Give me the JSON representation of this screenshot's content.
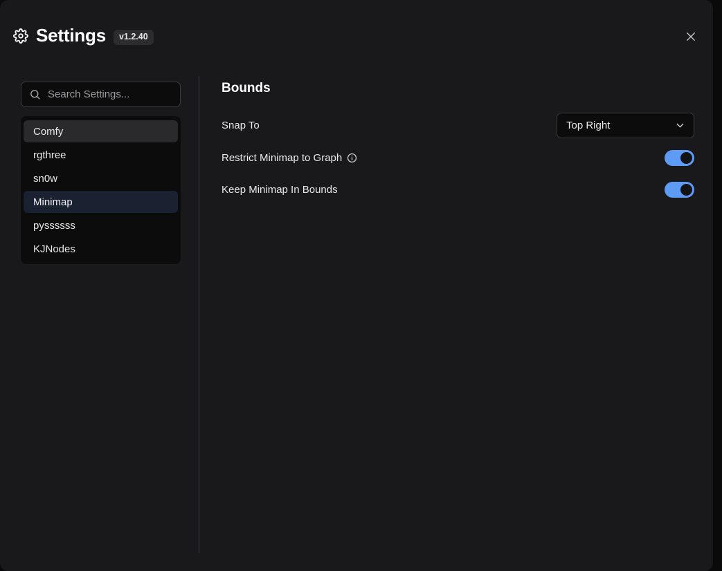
{
  "header": {
    "gear_icon": "gear-icon",
    "title": "Settings",
    "version": "v1.2.40",
    "close_icon": "close-icon"
  },
  "sidebar": {
    "search": {
      "icon": "search-icon",
      "value": "",
      "placeholder": "Search Settings..."
    },
    "items": [
      {
        "label": "Comfy",
        "state": "hovered"
      },
      {
        "label": "rgthree",
        "state": "default"
      },
      {
        "label": "sn0w",
        "state": "default"
      },
      {
        "label": "Minimap",
        "state": "selected"
      },
      {
        "label": "pyssssss",
        "state": "default"
      },
      {
        "label": "KJNodes",
        "state": "default"
      }
    ]
  },
  "content": {
    "section_title": "Bounds",
    "rows": [
      {
        "label": "Snap To",
        "control": "select",
        "value": "Top Right",
        "chevron_icon": "chevron-down-icon"
      },
      {
        "label": "Restrict Minimap to Graph",
        "control": "toggle",
        "info_icon": "info-circle-icon",
        "value": "on"
      },
      {
        "label": "Keep Minimap In Bounds",
        "control": "toggle",
        "value": "on"
      }
    ]
  },
  "colors": {
    "dialog_background": "#19191b",
    "panel_background": "#0c0c0d",
    "page_background": "#0a0a0b",
    "accent_toggle": "#5d9bf5",
    "selected_item": "#1a2231",
    "hovered_item": "#2a2a2c",
    "divider": "#3a3c40",
    "text_primary": "#e9e9ec"
  }
}
